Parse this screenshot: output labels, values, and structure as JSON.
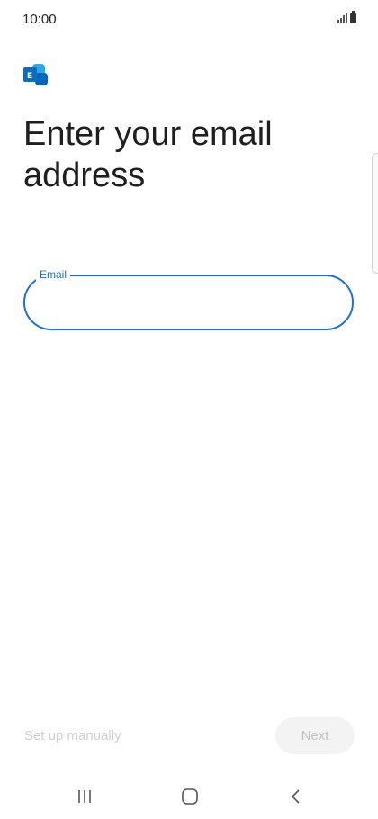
{
  "status_bar": {
    "time": "10:00",
    "icons": [
      "signal-icon",
      "battery-icon"
    ]
  },
  "app": {
    "logo_icon": "exchange-logo-icon",
    "brand_color": "#0f6cbd"
  },
  "page": {
    "title": "Enter your email address"
  },
  "email_field": {
    "label": "Email",
    "value": "",
    "placeholder": "",
    "accent_color": "#1f6fd1"
  },
  "actions": {
    "setup_manually_label": "Set up manually",
    "next_label": "Next"
  },
  "nav_bar": {
    "icons": [
      "recent-apps-icon",
      "home-icon",
      "back-icon"
    ]
  }
}
